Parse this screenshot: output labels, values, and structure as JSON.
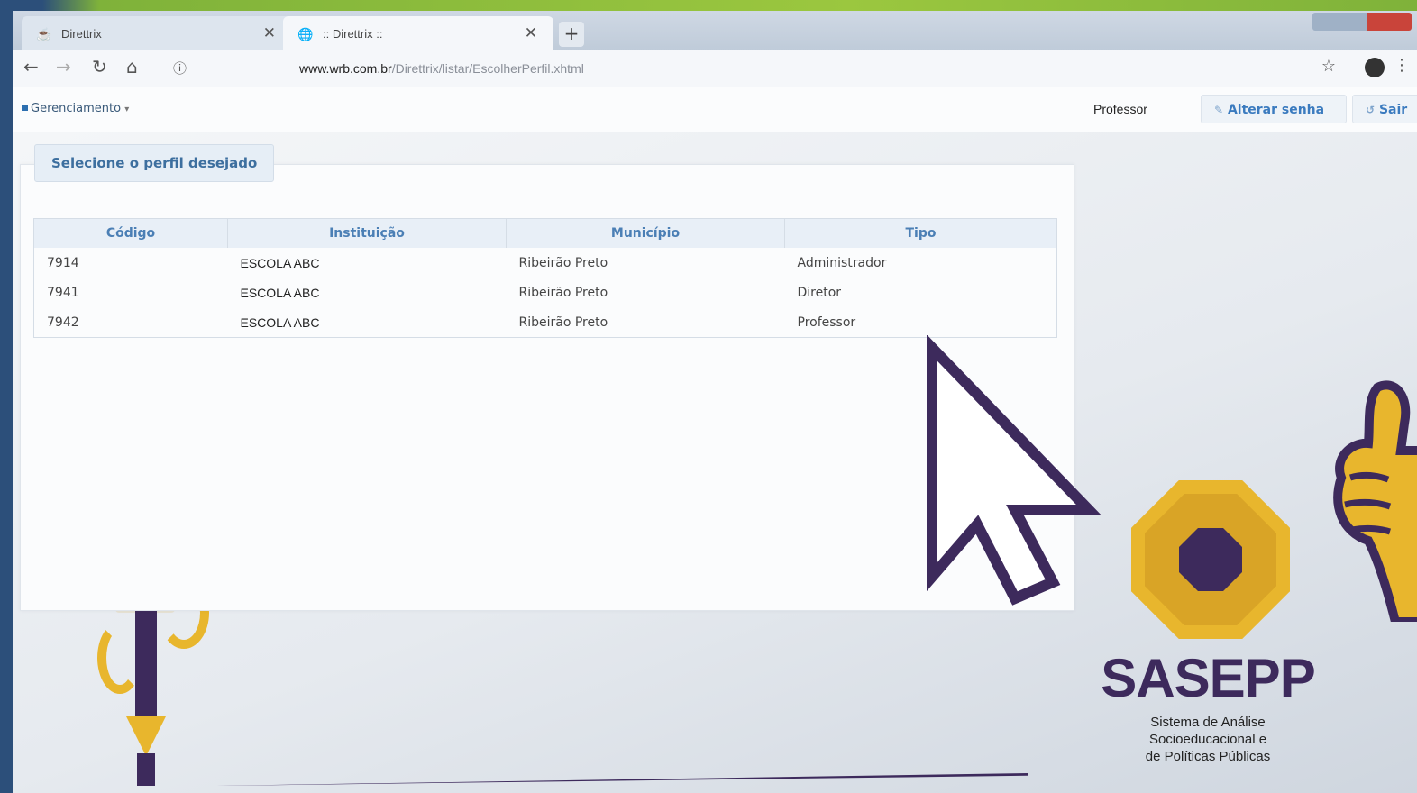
{
  "browser": {
    "tabs": [
      {
        "label": "Direttrix"
      },
      {
        "label": ":: Direttrix ::"
      }
    ],
    "new_tab_symbol": "+",
    "url_host": "www.wrb.com.br",
    "url_path": "/Direttrix/listar/EscolherPerfil.xhtml"
  },
  "nav": {
    "menu_label": "Gerenciamento",
    "user_role": "Professor",
    "change_password_label": "Alterar senha",
    "logout_label": "Sair"
  },
  "panel": {
    "legend": "Selecione o perfil desejado",
    "columns": [
      "Código",
      "Instituição",
      "Município",
      "Tipo"
    ],
    "rows": [
      {
        "codigo": "7914",
        "instituicao": "ESCOLA ABC",
        "municipio": "Ribeirão Preto",
        "tipo": "Administrador"
      },
      {
        "codigo": "7941",
        "instituicao": "ESCOLA ABC",
        "municipio": "Ribeirão Preto",
        "tipo": "Diretor"
      },
      {
        "codigo": "7942",
        "instituicao": "ESCOLA ABC",
        "municipio": "Ribeirão Preto",
        "tipo": "Professor"
      }
    ]
  },
  "logo": {
    "name": "SASEPP",
    "subtitle_line1": "Sistema de Análise",
    "subtitle_line2": "Socioeducacional e",
    "subtitle_line3": "de Políticas Públicas"
  },
  "colors": {
    "brand_purple": "#3d2a5c",
    "brand_yellow": "#e8b62d",
    "link_blue": "#3b7bbf"
  }
}
